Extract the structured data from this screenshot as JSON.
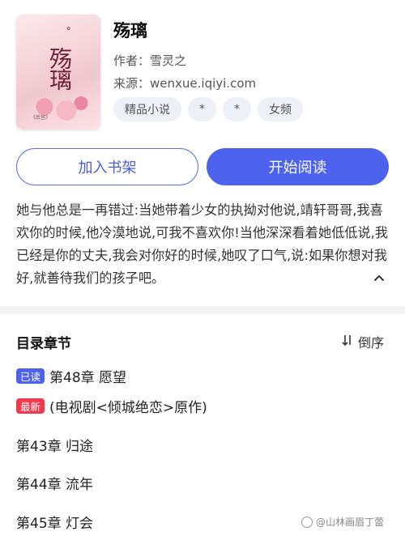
{
  "book": {
    "title": "殇璃",
    "author_label": "作者：",
    "author": "雪灵之",
    "source_label": "来源：",
    "source": "wenxue.iqiyi.com",
    "tags": [
      "精品小说",
      "*",
      "*",
      "女频"
    ],
    "cover_title": "殇璃",
    "cover_caption": "《后宫》"
  },
  "actions": {
    "add_shelf": "加入书架",
    "start_read": "开始阅读"
  },
  "description": "她与他总是一再错过:当她带着少女的执拗对他说,靖轩哥哥,我喜欢你的时候,他冷漠地说,可我不喜欢你!当他深深看着她低低说,我已经是你的丈夫,我会对你好的时候,她叹了口气,说:如果你想对我好,就善待我们的孩子吧。",
  "toc": {
    "title": "目录章节",
    "sort_label": "倒序",
    "chapters": [
      {
        "badge": "已读",
        "title": "第48章 愿望"
      },
      {
        "badge": "最新",
        "title": "(电视剧<倾城绝恋>原作)"
      },
      {
        "badge": "",
        "title": "第43章 归途"
      },
      {
        "badge": "",
        "title": "第44章 流年"
      },
      {
        "badge": "",
        "title": "第45章 灯会"
      }
    ]
  },
  "watermark": "@山林画眉丁蕾"
}
